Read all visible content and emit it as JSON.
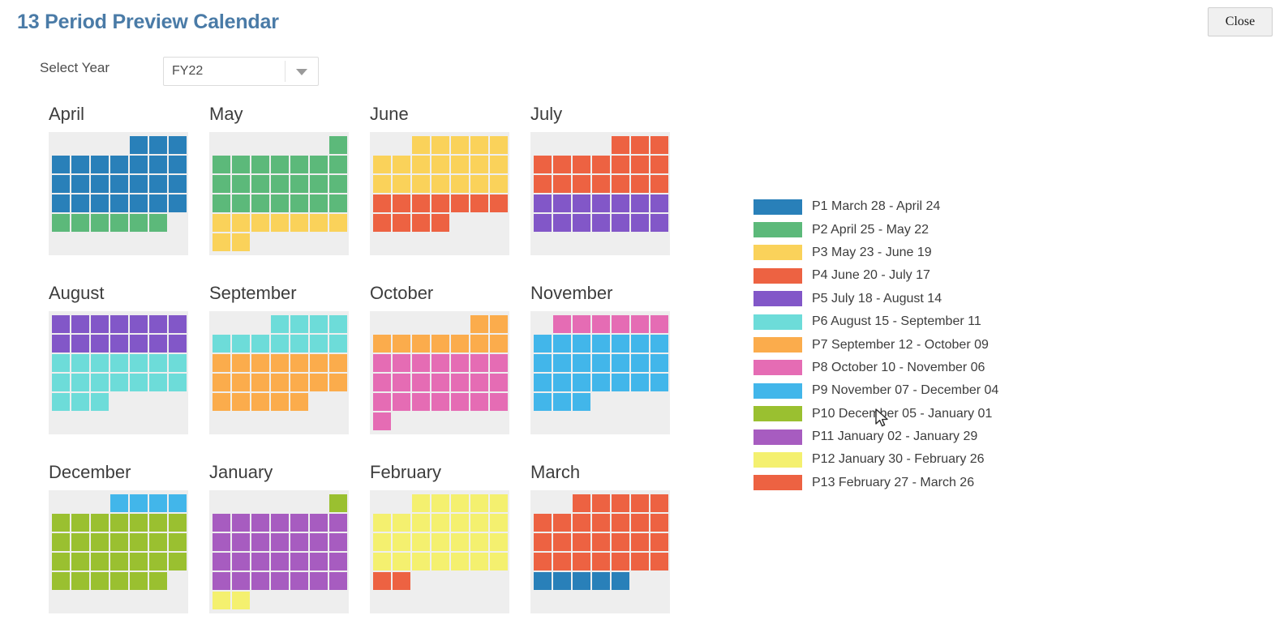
{
  "header": {
    "title": "13 Period Preview Calendar",
    "close_label": "Close"
  },
  "year_selector": {
    "label": "Select Year",
    "value": "FY22",
    "icon": "chevron-down-icon"
  },
  "palette": {
    "P1": "#2980b9",
    "P2": "#5cb97a",
    "P3": "#fad25a",
    "P4": "#ed6242",
    "P5": "#8257c8",
    "P6": "#6ddcd9",
    "P7": "#fbac4c",
    "P8": "#e56cb4",
    "P9": "#42b6ea",
    "P10": "#9ac030",
    "P11": "#a75cc0",
    "P12": "#f4f06f",
    "P13": "#ed6242",
    "empty": "#eeeeee",
    "panel_bg": "#eeeeee",
    "title_color": "#4a7ba7"
  },
  "legend": {
    "items": [
      {
        "period": "P1",
        "label": "P1 March 28 - April 24",
        "color": "#2980b9"
      },
      {
        "period": "P2",
        "label": "P2 April 25 - May 22",
        "color": "#5cb97a"
      },
      {
        "period": "P3",
        "label": "P3 May 23 - June 19",
        "color": "#fad25a"
      },
      {
        "period": "P4",
        "label": "P4 June 20 - July 17",
        "color": "#ed6242"
      },
      {
        "period": "P5",
        "label": "P5 July 18 - August 14",
        "color": "#8257c8"
      },
      {
        "period": "P6",
        "label": "P6 August 15 - September 11",
        "color": "#6ddcd9"
      },
      {
        "period": "P7",
        "label": "P7 September 12 - October 09",
        "color": "#fbac4c"
      },
      {
        "period": "P8",
        "label": "P8 October 10 - November 06",
        "color": "#e56cb4"
      },
      {
        "period": "P9",
        "label": "P9 November 07 - December 04",
        "color": "#42b6ea"
      },
      {
        "period": "P10",
        "label": "P10 December 05 - January 01",
        "color": "#9ac030"
      },
      {
        "period": "P11",
        "label": "P11 January 02 - January 29",
        "color": "#a75cc0"
      },
      {
        "period": "P12",
        "label": "P12 January 30 - February 26",
        "color": "#f4f06f"
      },
      {
        "period": "P13",
        "label": "P13 February 27 - March 26",
        "color": "#ed6242"
      }
    ]
  },
  "months": [
    {
      "name": "April",
      "col": 0,
      "row": 0,
      "cells": [
        null,
        null,
        null,
        null,
        "P1",
        "P1",
        "P1",
        "P1",
        "P1",
        "P1",
        "P1",
        "P1",
        "P1",
        "P1",
        "P1",
        "P1",
        "P1",
        "P1",
        "P1",
        "P1",
        "P1",
        "P1",
        "P1",
        "P1",
        "P1",
        "P1",
        "P1",
        "P1",
        "P2",
        "P2",
        "P2",
        "P2",
        "P2",
        "P2",
        null,
        null,
        null,
        null,
        null,
        null,
        null,
        null
      ]
    },
    {
      "name": "May",
      "col": 1,
      "row": 0,
      "cells": [
        null,
        null,
        null,
        null,
        null,
        null,
        "P2",
        "P2",
        "P2",
        "P2",
        "P2",
        "P2",
        "P2",
        "P2",
        "P2",
        "P2",
        "P2",
        "P2",
        "P2",
        "P2",
        "P2",
        "P2",
        "P2",
        "P2",
        "P2",
        "P2",
        "P2",
        "P2",
        "P3",
        "P3",
        "P3",
        "P3",
        "P3",
        "P3",
        "P3",
        "P3",
        "P3",
        null,
        null,
        null,
        null,
        null
      ]
    },
    {
      "name": "June",
      "col": 2,
      "row": 0,
      "cells": [
        null,
        null,
        "P3",
        "P3",
        "P3",
        "P3",
        "P3",
        "P3",
        "P3",
        "P3",
        "P3",
        "P3",
        "P3",
        "P3",
        "P3",
        "P3",
        "P3",
        "P3",
        "P3",
        "P3",
        "P3",
        "P4",
        "P4",
        "P4",
        "P4",
        "P4",
        "P4",
        "P4",
        "P4",
        "P4",
        "P4",
        "P4",
        null,
        null,
        null,
        null,
        null,
        null,
        null,
        null,
        null,
        null
      ]
    },
    {
      "name": "July",
      "col": 3,
      "row": 0,
      "cells": [
        null,
        null,
        null,
        null,
        "P4",
        "P4",
        "P4",
        "P4",
        "P4",
        "P4",
        "P4",
        "P4",
        "P4",
        "P4",
        "P4",
        "P4",
        "P4",
        "P4",
        "P4",
        "P4",
        "P4",
        "P5",
        "P5",
        "P5",
        "P5",
        "P5",
        "P5",
        "P5",
        "P5",
        "P5",
        "P5",
        "P5",
        "P5",
        "P5",
        "P5",
        null,
        null,
        null,
        null,
        null,
        null,
        null
      ]
    },
    {
      "name": "August",
      "col": 0,
      "row": 1,
      "cells": [
        "P5",
        "P5",
        "P5",
        "P5",
        "P5",
        "P5",
        "P5",
        "P5",
        "P5",
        "P5",
        "P5",
        "P5",
        "P5",
        "P5",
        "P6",
        "P6",
        "P6",
        "P6",
        "P6",
        "P6",
        "P6",
        "P6",
        "P6",
        "P6",
        "P6",
        "P6",
        "P6",
        "P6",
        "P6",
        "P6",
        "P6",
        null,
        null,
        null,
        null,
        null,
        null,
        null,
        null,
        null,
        null,
        null
      ]
    },
    {
      "name": "September",
      "col": 1,
      "row": 1,
      "cells": [
        null,
        null,
        null,
        "P6",
        "P6",
        "P6",
        "P6",
        "P6",
        "P6",
        "P6",
        "P6",
        "P6",
        "P6",
        "P6",
        "P7",
        "P7",
        "P7",
        "P7",
        "P7",
        "P7",
        "P7",
        "P7",
        "P7",
        "P7",
        "P7",
        "P7",
        "P7",
        "P7",
        "P7",
        "P7",
        "P7",
        "P7",
        "P7",
        null,
        null,
        null,
        null,
        null,
        null,
        null,
        null,
        null
      ]
    },
    {
      "name": "October",
      "col": 2,
      "row": 1,
      "cells": [
        null,
        null,
        null,
        null,
        null,
        "P7",
        "P7",
        "P7",
        "P7",
        "P7",
        "P7",
        "P7",
        "P7",
        "P7",
        "P8",
        "P8",
        "P8",
        "P8",
        "P8",
        "P8",
        "P8",
        "P8",
        "P8",
        "P8",
        "P8",
        "P8",
        "P8",
        "P8",
        "P8",
        "P8",
        "P8",
        "P8",
        "P8",
        "P8",
        "P8",
        "P8",
        null,
        null,
        null,
        null,
        null,
        null
      ]
    },
    {
      "name": "November",
      "col": 3,
      "row": 1,
      "cells": [
        null,
        "P8",
        "P8",
        "P8",
        "P8",
        "P8",
        "P8",
        "P9",
        "P9",
        "P9",
        "P9",
        "P9",
        "P9",
        "P9",
        "P9",
        "P9",
        "P9",
        "P9",
        "P9",
        "P9",
        "P9",
        "P9",
        "P9",
        "P9",
        "P9",
        "P9",
        "P9",
        "P9",
        "P9",
        "P9",
        "P9",
        null,
        null,
        null,
        null,
        null,
        null,
        null,
        null,
        null,
        null,
        null
      ]
    },
    {
      "name": "December",
      "col": 0,
      "row": 2,
      "cells": [
        null,
        null,
        null,
        "P9",
        "P9",
        "P9",
        "P9",
        "P10",
        "P10",
        "P10",
        "P10",
        "P10",
        "P10",
        "P10",
        "P10",
        "P10",
        "P10",
        "P10",
        "P10",
        "P10",
        "P10",
        "P10",
        "P10",
        "P10",
        "P10",
        "P10",
        "P10",
        "P10",
        "P10",
        "P10",
        "P10",
        "P10",
        "P10",
        "P10",
        null,
        null,
        null,
        null,
        null,
        null,
        null,
        null
      ]
    },
    {
      "name": "January",
      "col": 1,
      "row": 2,
      "cells": [
        null,
        null,
        null,
        null,
        null,
        null,
        "P10",
        "P11",
        "P11",
        "P11",
        "P11",
        "P11",
        "P11",
        "P11",
        "P11",
        "P11",
        "P11",
        "P11",
        "P11",
        "P11",
        "P11",
        "P11",
        "P11",
        "P11",
        "P11",
        "P11",
        "P11",
        "P11",
        "P11",
        "P11",
        "P11",
        "P11",
        "P11",
        "P11",
        "P11",
        "P12",
        "P12",
        null,
        null,
        null,
        null,
        null
      ]
    },
    {
      "name": "February",
      "col": 2,
      "row": 2,
      "cells": [
        null,
        null,
        "P12",
        "P12",
        "P12",
        "P12",
        "P12",
        "P12",
        "P12",
        "P12",
        "P12",
        "P12",
        "P12",
        "P12",
        "P12",
        "P12",
        "P12",
        "P12",
        "P12",
        "P12",
        "P12",
        "P12",
        "P12",
        "P12",
        "P12",
        "P12",
        "P12",
        "P12",
        "P13",
        "P13",
        null,
        null,
        null,
        null,
        null,
        null,
        null,
        null,
        null,
        null,
        null,
        null
      ]
    },
    {
      "name": "March",
      "col": 3,
      "row": 2,
      "cells": [
        null,
        null,
        "P13",
        "P13",
        "P13",
        "P13",
        "P13",
        "P13",
        "P13",
        "P13",
        "P13",
        "P13",
        "P13",
        "P13",
        "P13",
        "P13",
        "P13",
        "P13",
        "P13",
        "P13",
        "P13",
        "P13",
        "P13",
        "P13",
        "P13",
        "P13",
        "P13",
        "P13",
        "P1",
        "P1",
        "P1",
        "P1",
        "P1",
        null,
        null,
        null,
        null,
        null,
        null,
        null,
        null,
        null
      ]
    }
  ]
}
